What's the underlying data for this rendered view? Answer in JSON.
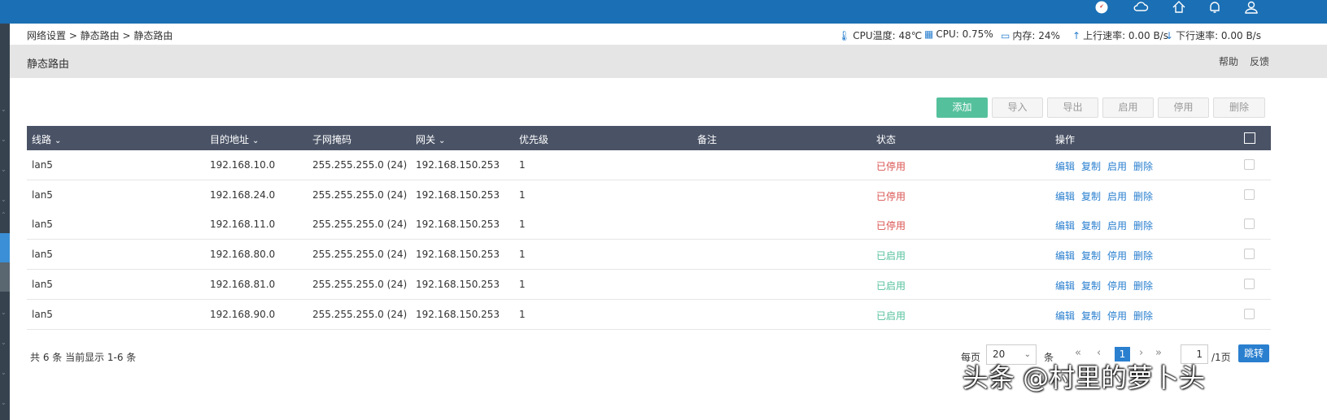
{
  "topbar": {
    "icons": [
      "compass-icon",
      "cloud-icon",
      "home-icon",
      "bell-icon",
      "user-icon"
    ]
  },
  "breadcrumb": "网络设置 > 静态路由 > 静态路由",
  "stats": {
    "cpu_temp": "CPU温度: 48℃",
    "cpu": "CPU: 0.75%",
    "memory": "内存: 24%",
    "upload": "上行速率: 0.00 B/s",
    "download": "下行速率: 0.00 B/s"
  },
  "page": {
    "title": "静态路由",
    "help": "帮助",
    "feedback": "反馈"
  },
  "toolbar": {
    "add": "添加",
    "import": "导入",
    "export": "导出",
    "enable": "启用",
    "disable": "停用",
    "delete": "删除"
  },
  "table": {
    "headers": {
      "line": "线路",
      "dest": "目的地址",
      "mask": "子网掩码",
      "gateway": "网关",
      "priority": "优先级",
      "remark": "备注",
      "status": "状态",
      "ops": "操作"
    },
    "rows": [
      {
        "line": "lan5",
        "dest": "192.168.10.0",
        "mask": "255.255.255.0 (24)",
        "gateway": "192.168.150.253",
        "priority": "1",
        "remark": "",
        "status": "已停用",
        "edit": "编辑",
        "copy": "复制",
        "toggle": "启用",
        "delete": "删除"
      },
      {
        "line": "lan5",
        "dest": "192.168.24.0",
        "mask": "255.255.255.0 (24)",
        "gateway": "192.168.150.253",
        "priority": "1",
        "remark": "",
        "status": "已停用",
        "edit": "编辑",
        "copy": "复制",
        "toggle": "启用",
        "delete": "删除"
      },
      {
        "line": "lan5",
        "dest": "192.168.11.0",
        "mask": "255.255.255.0 (24)",
        "gateway": "192.168.150.253",
        "priority": "1",
        "remark": "",
        "status": "已停用",
        "edit": "编辑",
        "copy": "复制",
        "toggle": "启用",
        "delete": "删除"
      },
      {
        "line": "lan5",
        "dest": "192.168.80.0",
        "mask": "255.255.255.0 (24)",
        "gateway": "192.168.150.253",
        "priority": "1",
        "remark": "",
        "status": "已启用",
        "edit": "编辑",
        "copy": "复制",
        "toggle": "停用",
        "delete": "删除"
      },
      {
        "line": "lan5",
        "dest": "192.168.81.0",
        "mask": "255.255.255.0 (24)",
        "gateway": "192.168.150.253",
        "priority": "1",
        "remark": "",
        "status": "已启用",
        "edit": "编辑",
        "copy": "复制",
        "toggle": "停用",
        "delete": "删除"
      },
      {
        "line": "lan5",
        "dest": "192.168.90.0",
        "mask": "255.255.255.0 (24)",
        "gateway": "192.168.150.253",
        "priority": "1",
        "remark": "",
        "status": "已启用",
        "edit": "编辑",
        "copy": "复制",
        "toggle": "停用",
        "delete": "删除"
      }
    ]
  },
  "summary": "共 6 条 当前显示 1-6 条",
  "pagination": {
    "per_page_label": "每页",
    "per_page_value": "20",
    "unit": "条",
    "first": "«",
    "prev": "‹",
    "current": "1",
    "next": "›",
    "last": "»",
    "goto_value": "1",
    "total_pages": "/1页",
    "go": "跳转"
  },
  "colors": {
    "topbar": "#1b6fb4",
    "header": "#4a5366",
    "primary": "#55c19c",
    "disabled_status": "#d9534f",
    "enabled_status": "#55c19c",
    "link": "#2a7fcf"
  },
  "watermark": "头条 @村里的萝卜头"
}
